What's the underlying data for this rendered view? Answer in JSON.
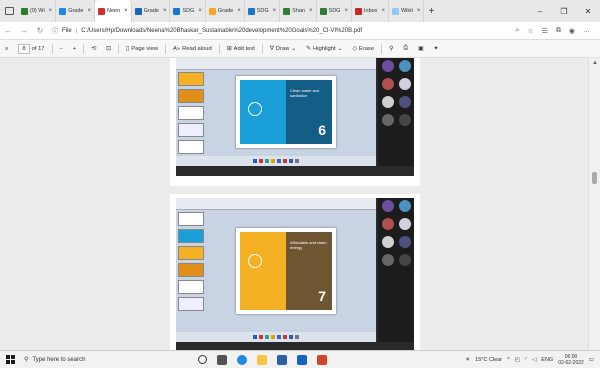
{
  "tabs": [
    {
      "label": "(9) Wi",
      "color": "#2a7d2a",
      "active": false
    },
    {
      "label": "Grade",
      "color": "#1e88e5",
      "active": false
    },
    {
      "label": "Neen",
      "color": "#d32f2f",
      "active": true
    },
    {
      "label": "Grade",
      "color": "#1565c0",
      "active": false
    },
    {
      "label": "SDG",
      "color": "#1976d2",
      "active": false
    },
    {
      "label": "Grade",
      "color": "#f9a825",
      "active": false
    },
    {
      "label": "SDG",
      "color": "#1976d2",
      "active": false
    },
    {
      "label": "Shan",
      "color": "#2e7d32",
      "active": false
    },
    {
      "label": "SDG",
      "color": "#2e7d32",
      "active": false
    },
    {
      "label": "Inbox",
      "color": "#c62828",
      "active": false
    },
    {
      "label": "Wikti",
      "color": "#90caf9",
      "active": false
    }
  ],
  "address": {
    "scheme_label": "File",
    "url": "C:/Users/Hp/Downloads/Neena%20Bhaskar_Sustainable%20development%20Goals%20_Cl-VI%20B.pdf"
  },
  "pdf_toolbar": {
    "page_current": "8",
    "page_total": "of 17",
    "zoom_out": "−",
    "zoom_in": "+",
    "page_view": "Page view",
    "read_aloud": "Read aloud",
    "add_text": "Add text",
    "draw": "Draw",
    "highlight": "Highlight",
    "erase": "Erase"
  },
  "slides": [
    {
      "left_color": "#1a9fd8",
      "right_color": "#135d86",
      "number": "6",
      "caption": "Clean water and sanitation"
    },
    {
      "left_color": "#f4b123",
      "right_color": "#6e5632",
      "number": "7",
      "caption": "Affordable and clean energy"
    }
  ],
  "taskbar": {
    "search_placeholder": "Type here to search",
    "weather": "15°C  Clear",
    "lang": "ENG",
    "time": "06:00",
    "date": "02-02-2022"
  }
}
